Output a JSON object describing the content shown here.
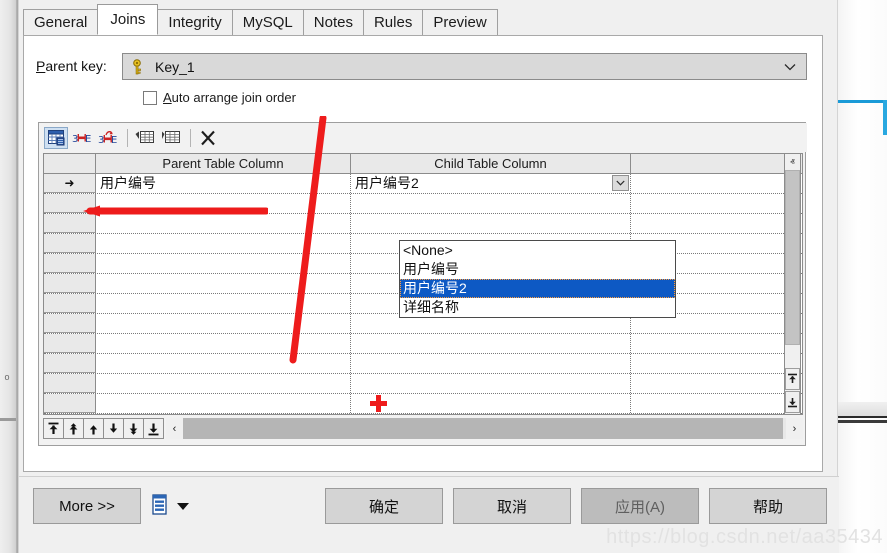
{
  "dialog": {
    "tabs": [
      {
        "label": "General",
        "active": false
      },
      {
        "label": "Joins",
        "active": true
      },
      {
        "label": "Integrity",
        "active": false
      },
      {
        "label": "MySQL",
        "active": false
      },
      {
        "label": "Notes",
        "active": false
      },
      {
        "label": "Rules",
        "active": false
      },
      {
        "label": "Preview",
        "active": false
      }
    ],
    "parent_key": {
      "label": "Parent key:",
      "label_accel": "P",
      "label_rest": "arent key:",
      "icon": "key-icon",
      "value": "Key_1",
      "dropdown_icon": "chevron-down-icon"
    },
    "auto_arrange": {
      "label_accel": "A",
      "label_rest": "uto arrange join order",
      "full_label": "Auto arrange join order",
      "checked": false
    },
    "toolbar": {
      "buttons": [
        {
          "name": "grid-table-icon",
          "title": "Show table grid",
          "pressed": true
        },
        {
          "name": "join-link-icon",
          "title": "Add join",
          "pressed": false
        },
        {
          "name": "join-unlink-icon",
          "title": "Remove join",
          "pressed": false
        },
        {
          "name": "insert-table-left-icon",
          "title": "Insert column before",
          "pressed": false
        },
        {
          "name": "insert-table-right-icon",
          "title": "Insert column after",
          "pressed": false
        },
        {
          "name": "delete-x-icon",
          "title": "Delete",
          "pressed": false
        }
      ]
    },
    "grid": {
      "headers": [
        "",
        "Parent Table Column",
        "Child Table Column",
        ""
      ],
      "rows": [
        {
          "marker": "➜",
          "parent": "用户编号",
          "child": "用户编号2",
          "active": true
        },
        {
          "marker": "",
          "parent": "",
          "child": "",
          "active": false
        },
        {
          "marker": "",
          "parent": "",
          "child": "",
          "active": false
        },
        {
          "marker": "",
          "parent": "",
          "child": "",
          "active": false
        },
        {
          "marker": "",
          "parent": "",
          "child": "",
          "active": false
        },
        {
          "marker": "",
          "parent": "",
          "child": "",
          "active": false
        },
        {
          "marker": "",
          "parent": "",
          "child": "",
          "active": false
        },
        {
          "marker": "",
          "parent": "",
          "child": "",
          "active": false
        },
        {
          "marker": "",
          "parent": "",
          "child": "",
          "active": false
        },
        {
          "marker": "",
          "parent": "",
          "child": "",
          "active": false
        },
        {
          "marker": "",
          "parent": "",
          "child": "",
          "active": false
        },
        {
          "marker": "",
          "parent": "",
          "child": "",
          "active": false
        }
      ]
    },
    "dropdown": {
      "open": true,
      "items": [
        {
          "label": "<None>",
          "selected": false
        },
        {
          "label": "用户编号",
          "selected": false
        },
        {
          "label": "用户编号2",
          "selected": true
        },
        {
          "label": "详细名称",
          "selected": false
        }
      ],
      "highlight_color": "#0d59c4"
    },
    "record_nav": [
      {
        "name": "nav-first-record",
        "glyph": "first"
      },
      {
        "name": "nav-prev-page",
        "glyph": "prev-page"
      },
      {
        "name": "nav-prev-record",
        "glyph": "prev"
      },
      {
        "name": "nav-next-record",
        "glyph": "next"
      },
      {
        "name": "nav-next-page",
        "glyph": "next-page"
      },
      {
        "name": "nav-last-record",
        "glyph": "last"
      }
    ],
    "scrollbars": {
      "h_left_arrow": "‹",
      "h_right_arrow": "›",
      "v_up_arrow": "ⱏ",
      "v_down_arrow": "ⱟ",
      "v_top_glyph": "⤒",
      "v_bottom_glyph": "⤓"
    },
    "footer": {
      "more": "More >>",
      "print_icon": "print-icon",
      "print_dropdown_icon": "triangle-down-icon",
      "ok": "确定",
      "cancel": "取消",
      "apply": "应用(A)",
      "apply_disabled": true,
      "help": "帮助"
    }
  },
  "annotations": {
    "red_arrow_left": "red-annotation-arrow",
    "red_vertical_line": "red-annotation-line",
    "red_plus_cursor": "red-plus-cursor",
    "color": "#ee1c1c"
  },
  "watermark": {
    "text": "https://blog.csdn.net/aa35434"
  },
  "background": {
    "left_marker": "o",
    "blue_accent": "#1a9ad7"
  }
}
